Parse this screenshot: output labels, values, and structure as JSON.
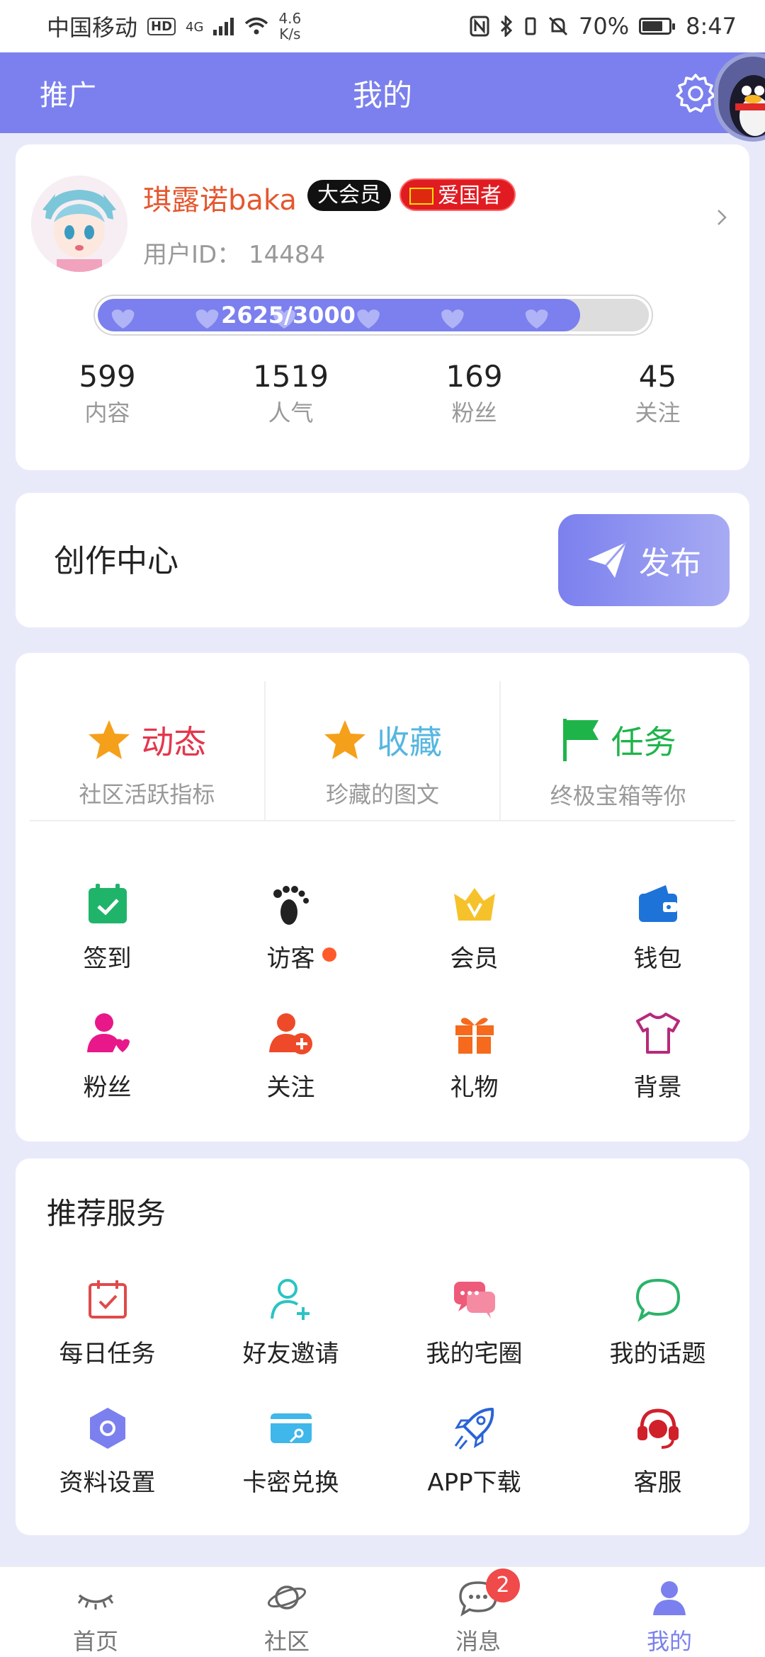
{
  "status_bar": {
    "carrier": "中国移动",
    "hd": "HD",
    "network": "4G",
    "speed_value": "4.6",
    "speed_unit": "K/s",
    "battery": "70%",
    "time": "8:47"
  },
  "app_bar": {
    "promo_label": "推广",
    "title": "我的"
  },
  "profile": {
    "name": "琪露诺baka",
    "vip_badge": "大会员",
    "patriot_badge": "爱国者",
    "uid_label": "用户ID：",
    "uid_value": "14484",
    "exp_text": "2625/3000",
    "exp_progress": 0.875,
    "stats": [
      {
        "value": "599",
        "label": "内容"
      },
      {
        "value": "1519",
        "label": "人气"
      },
      {
        "value": "169",
        "label": "粉丝"
      },
      {
        "value": "45",
        "label": "关注"
      }
    ]
  },
  "creation": {
    "label": "创作中心",
    "publish_label": "发布"
  },
  "features": {
    "highlights": [
      {
        "title": "动态",
        "subtitle": "社区活跃指标",
        "icon": "star-icon",
        "color": "#e4364d"
      },
      {
        "title": "收藏",
        "subtitle": "珍藏的图文",
        "icon": "star-icon",
        "color": "#55b6e0"
      },
      {
        "title": "任务",
        "subtitle": "终极宝箱等你",
        "icon": "flag-icon",
        "color": "#1fb44a"
      }
    ],
    "grid": [
      {
        "label": "签到",
        "icon": "calendar-check-icon",
        "color": "#1fb46a"
      },
      {
        "label": "访客",
        "icon": "footprint-icon",
        "color": "#222222"
      },
      {
        "label": "会员",
        "icon": "crown-icon",
        "color": "#f6c22c"
      },
      {
        "label": "钱包",
        "icon": "wallet-icon",
        "color": "#1e73d8"
      },
      {
        "label": "粉丝",
        "icon": "user-heart-icon",
        "color": "#e8188a"
      },
      {
        "label": "关注",
        "icon": "user-add-icon",
        "color": "#ee4a2a"
      },
      {
        "label": "礼物",
        "icon": "gift-icon",
        "color": "#f56a1c"
      },
      {
        "label": "背景",
        "icon": "tshirt-icon",
        "color": "#b62a7a"
      }
    ]
  },
  "services": {
    "title": "推荐服务",
    "items": [
      {
        "label": "每日任务",
        "icon": "daily-task-icon",
        "color": "#e04a4a"
      },
      {
        "label": "好友邀请",
        "icon": "invite-friend-icon",
        "color": "#2cc3c3"
      },
      {
        "label": "我的宅圈",
        "icon": "chat-bubbles-icon",
        "color": "#ee5a7a"
      },
      {
        "label": "我的话题",
        "icon": "chat-bubble-icon",
        "color": "#2bb36a"
      },
      {
        "label": "资料设置",
        "icon": "hexagon-settings-icon",
        "color": "#7b80ee"
      },
      {
        "label": "卡密兑换",
        "icon": "card-key-icon",
        "color": "#3fb7ea"
      },
      {
        "label": "APP下载",
        "icon": "rocket-icon",
        "color": "#2a64d8"
      },
      {
        "label": "客服",
        "icon": "headset-icon",
        "color": "#d0202a"
      }
    ]
  },
  "tabbar": {
    "tabs": [
      {
        "label": "首页",
        "icon": "eye-icon"
      },
      {
        "label": "社区",
        "icon": "planet-icon"
      },
      {
        "label": "消息",
        "icon": "message-icon",
        "badge": "2"
      },
      {
        "label": "我的",
        "icon": "user-icon"
      }
    ],
    "active_color": "#7b80ee"
  }
}
